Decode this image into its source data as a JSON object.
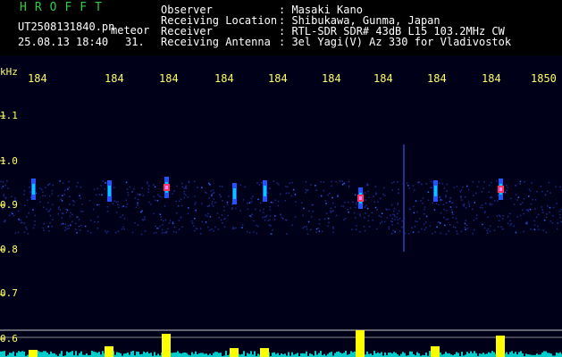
{
  "header": {
    "logo": "HROFFT",
    "filename": "UT2508131840.pn",
    "mode": "meteor",
    "datetime": "25.08.13 18:40",
    "seconds": "31.",
    "labels": [
      "Observer",
      "Receiving Location",
      "Receiver",
      "Receiving Antenna"
    ],
    "values": [
      ": Masaki Kano",
      ": Shibukawa, Gunma, Japan",
      ": RTL-SDR SDR# 43dB L15 103.2MHz CW",
      ": 3el Yagi(V) Az 330 for Vladivostok"
    ]
  },
  "time_ticks": [
    "184",
    "184",
    "184",
    "184",
    "184",
    "184",
    "184",
    "184",
    "184",
    "1850"
  ],
  "y_axis": {
    "unit": "kHz",
    "labels": [
      "1.1",
      "1.0",
      "0.9",
      "0.8",
      "0.7",
      "0.6"
    ]
  },
  "colors": {
    "background": "#000000",
    "logo": "#2ecc40",
    "ticks": "#ffff66",
    "meter_yellow": "#ffff00",
    "meter_cyan": "#00cccc"
  }
}
